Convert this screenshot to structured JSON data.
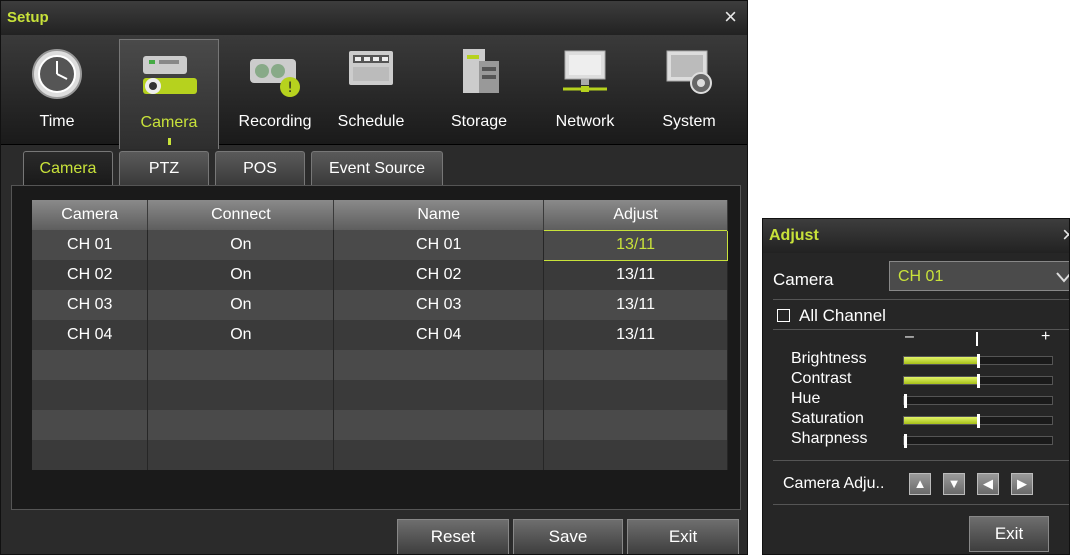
{
  "setup": {
    "title": "Setup",
    "close_glyph": "×",
    "toolbar": [
      {
        "label": "Time",
        "icon": "clock-icon"
      },
      {
        "label": "Camera",
        "icon": "camera-icon",
        "active": true
      },
      {
        "label": "Recording",
        "icon": "recording-icon"
      },
      {
        "label": "Schedule",
        "icon": "schedule-icon"
      },
      {
        "label": "Storage",
        "icon": "storage-icon"
      },
      {
        "label": "Network",
        "icon": "network-icon"
      },
      {
        "label": "System",
        "icon": "system-icon"
      }
    ],
    "subtabs": [
      "Camera",
      "PTZ",
      "POS",
      "Event Source"
    ],
    "table": {
      "headers": [
        "Camera",
        "Connect",
        "Name",
        "Adjust"
      ],
      "rows": [
        [
          "CH 01",
          "On",
          "CH 01",
          "13/11"
        ],
        [
          "CH 02",
          "On",
          "CH 02",
          "13/11"
        ],
        [
          "CH 03",
          "On",
          "CH 03",
          "13/11"
        ],
        [
          "CH 04",
          "On",
          "CH 04",
          "13/11"
        ]
      ]
    },
    "buttons": {
      "reset": "Reset",
      "save": "Save",
      "exit": "Exit"
    }
  },
  "adjust": {
    "title": "Adjust",
    "close_glyph": "×",
    "camera_label": "Camera",
    "camera_value": "CH 01",
    "all_channel_label": "All Channel",
    "minus": "–",
    "plus": "+",
    "sliders": [
      {
        "label": "Brightness",
        "level": 0.5
      },
      {
        "label": "Contrast",
        "level": 0.5
      },
      {
        "label": "Hue",
        "level": 0.0
      },
      {
        "label": "Saturation",
        "level": 0.5
      },
      {
        "label": "Sharpness",
        "level": 0.0
      }
    ],
    "camera_adjust_label": "Camera Adju..",
    "exit_label": "Exit"
  },
  "colors": {
    "accent": "#c8e23a",
    "background": "#2b2b2b"
  }
}
